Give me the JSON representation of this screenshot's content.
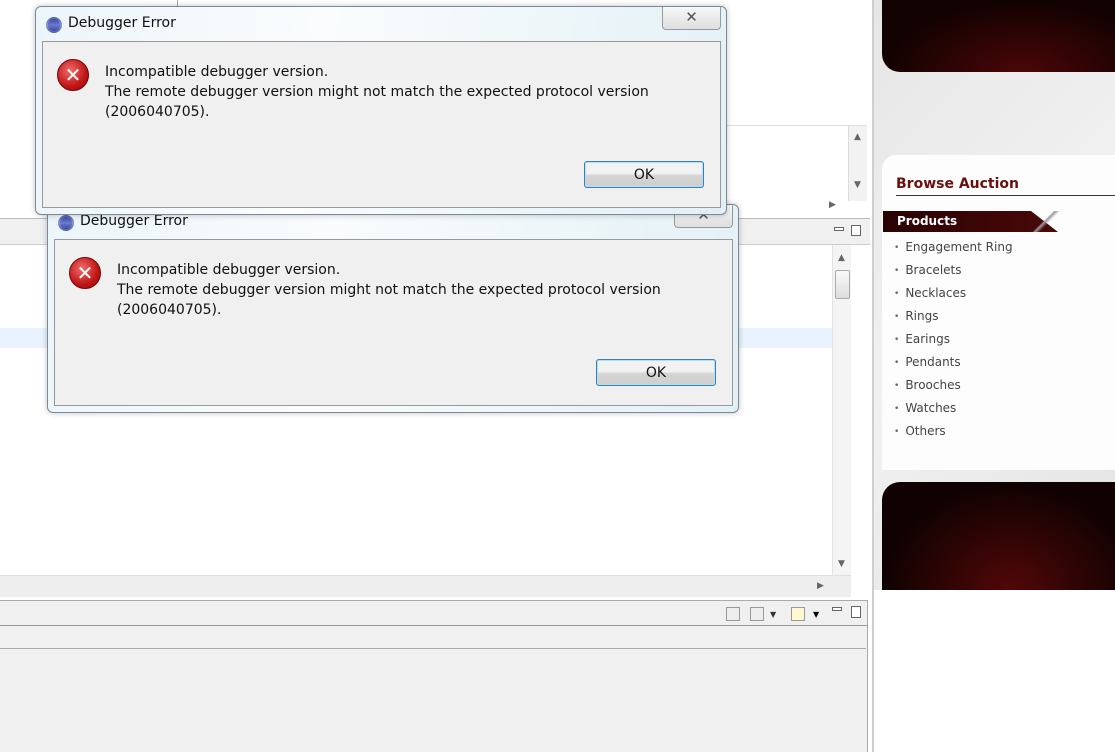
{
  "dialogs": [
    {
      "title": "Debugger Error",
      "message_line1": "Incompatible debugger version.",
      "message_line2": "The remote debugger version might not match the expected protocol version",
      "message_line3": "(2006040705).",
      "ok_label": "OK",
      "close_glyph": "✕"
    },
    {
      "title": "Debugger Error",
      "message_line1": "Incompatible debugger version.",
      "message_line2": "The remote debugger version might not match the expected protocol version",
      "message_line3": "(2006040705).",
      "ok_label": "OK",
      "close_glyph": "✕"
    }
  ],
  "web": {
    "heading": "Browse Auction",
    "products_label": "Products",
    "items": [
      "Engagement Ring",
      "Bracelets",
      "Necklaces",
      "Rings",
      "Earings",
      "Pendants",
      "Brooches",
      "Watches",
      "Others"
    ],
    "colors": {
      "heading": "#6b0f0f",
      "banner": "#4a0606"
    }
  },
  "icons": [
    "eclipse-icon",
    "error-icon",
    "close-icon",
    "minimize-icon",
    "maximize-icon",
    "scroll-up-icon",
    "scroll-down-icon",
    "scroll-right-icon",
    "pin-console-icon",
    "display-console-icon",
    "open-console-icon"
  ]
}
